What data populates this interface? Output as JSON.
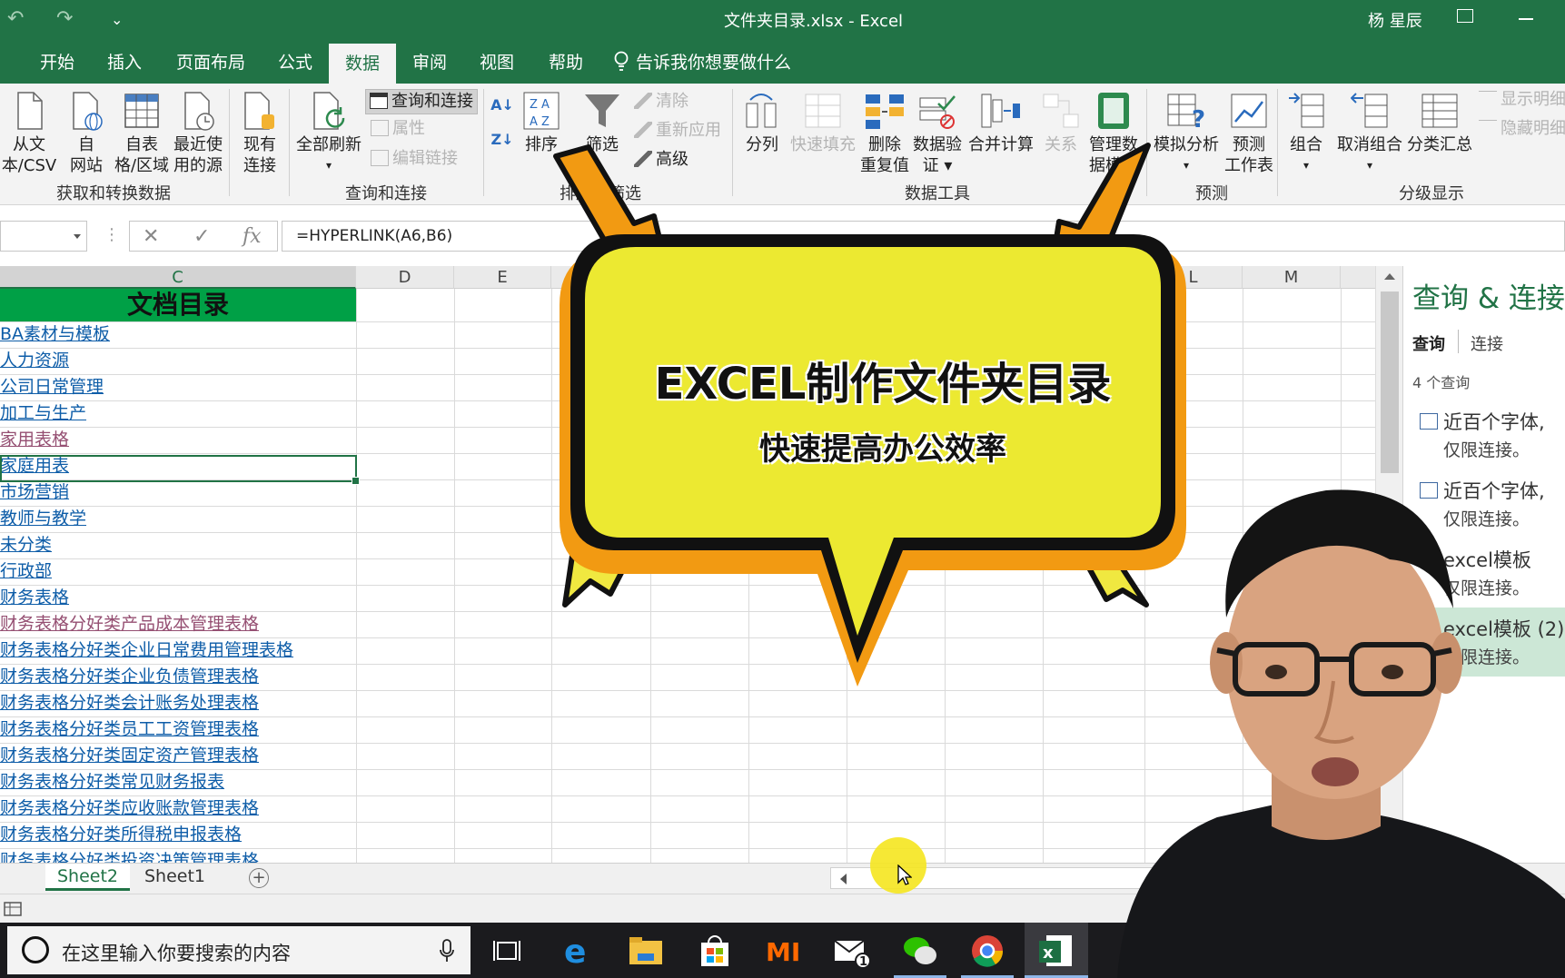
{
  "titlebar": {
    "undo": "↶",
    "redo": "↷",
    "customize": "⌄",
    "title": "文件夹目录.xlsx  -  Excel",
    "user": "杨 星辰"
  },
  "tabs": [
    {
      "label": "开始"
    },
    {
      "label": "插入"
    },
    {
      "label": "页面布局"
    },
    {
      "label": "公式"
    },
    {
      "label": "数据"
    },
    {
      "label": "审阅"
    },
    {
      "label": "视图"
    },
    {
      "label": "帮助"
    },
    {
      "label": "告诉我你想要做什么"
    }
  ],
  "ribbon": {
    "get_data": {
      "from_text_l1": "从文",
      "from_text_l2": "本/CSV",
      "from_web_l1": "自",
      "from_web_l2": "网站",
      "from_table_l1": "自表",
      "from_table_l2": "格/区域",
      "recent_l1": "最近使",
      "recent_l2": "用的源",
      "existing_l1": "现有",
      "existing_l2": "连接",
      "group": "获取和转换数据"
    },
    "queries": {
      "refresh_all": "全部刷新",
      "queries_connections": "查询和连接",
      "properties": "属性",
      "edit_links": "编辑链接",
      "group": "查询和连接"
    },
    "sort_filter": {
      "sort": "排序",
      "filter": "筛选",
      "clear": "清除",
      "reapply": "重新应用",
      "advanced": "高级",
      "group": "排序和筛选"
    },
    "data_tools": {
      "split": "分列",
      "flash_fill": "快速填充",
      "remove_dup_l1": "删除",
      "remove_dup_l2": "重复值",
      "validation_l1": "数据验",
      "validation_l2": "证 ▾",
      "consolidate": "合并计算",
      "relations": "关系",
      "model_l1": "管理数",
      "model_l2": "据模型",
      "group": "数据工具"
    },
    "forecast": {
      "whatif": "模拟分析",
      "sheet_l1": "预测",
      "sheet_l2": "工作表",
      "group": "预测"
    },
    "outline": {
      "group_btn": "组合",
      "ungroup": "取消组合",
      "subtotal": "分类汇总",
      "show_detail": "显示明细",
      "hide_detail": "隐藏明细",
      "group": "分级显示"
    }
  },
  "formulabar": {
    "cancel": "✕",
    "enter": "✓",
    "fx": "fx",
    "formula": "=HYPERLINK(A6,B6)"
  },
  "columns": [
    "C",
    "D",
    "E",
    "L",
    "M"
  ],
  "sheet": {
    "header": "文档目录",
    "rows": [
      {
        "text": "BA素材与模板",
        "visited": false
      },
      {
        "text": "人力资源",
        "visited": false
      },
      {
        "text": "公司日常管理",
        "visited": false
      },
      {
        "text": "加工与生产",
        "visited": false
      },
      {
        "text": "家用表格",
        "visited": true
      },
      {
        "text": "家庭用表",
        "visited": false
      },
      {
        "text": "市场营销",
        "visited": false
      },
      {
        "text": "教师与教学",
        "visited": false
      },
      {
        "text": "未分类",
        "visited": false
      },
      {
        "text": "行政部",
        "visited": false
      },
      {
        "text": "财务表格",
        "visited": false
      },
      {
        "text": "财务表格分好类产品成本管理表格",
        "visited": true
      },
      {
        "text": "财务表格分好类企业日常费用管理表格",
        "visited": false
      },
      {
        "text": "财务表格分好类企业负债管理表格",
        "visited": false
      },
      {
        "text": "财务表格分好类会计账务处理表格",
        "visited": false
      },
      {
        "text": "财务表格分好类员工工资管理表格",
        "visited": false
      },
      {
        "text": "财务表格分好类固定资产管理表格",
        "visited": false
      },
      {
        "text": "财务表格分好类常见财务报表",
        "visited": false
      },
      {
        "text": "财务表格分好类应收账款管理表格",
        "visited": false
      },
      {
        "text": "财务表格分好类所得税申报表格",
        "visited": false
      },
      {
        "text": "财务表格分好类投资决策管理表格",
        "visited": false
      }
    ]
  },
  "sheettabs": [
    {
      "label": "Sheet2",
      "active": true
    },
    {
      "label": "Sheet1",
      "active": false
    }
  ],
  "add_sheet": "+",
  "panel": {
    "title": "查询 & 连接",
    "tab_queries": "查询",
    "tab_connections": "连接",
    "count": "4 个查询",
    "items": [
      {
        "name": "近百个字体,",
        "desc": "仅限连接。"
      },
      {
        "name": "近百个字体,",
        "desc": "仅限连接。"
      },
      {
        "name": "excel模板",
        "desc": "仅限连接。"
      },
      {
        "name": "excel模板 (2)",
        "desc": "仅限连接。"
      }
    ]
  },
  "taskbar": {
    "search_placeholder": "在这里输入你要搜索的内容",
    "mail_badge": "1"
  },
  "bubble": {
    "title": "EXCEL制作文件夹目录",
    "subtitle": "快速提高办公效率"
  },
  "colors": {
    "excel_green": "#217346",
    "header_green": "#00a046",
    "link": "#0e5da8",
    "visited_link": "#954f72",
    "bubble_yellow": "#ece931",
    "bubble_orange": "#f29a12"
  }
}
